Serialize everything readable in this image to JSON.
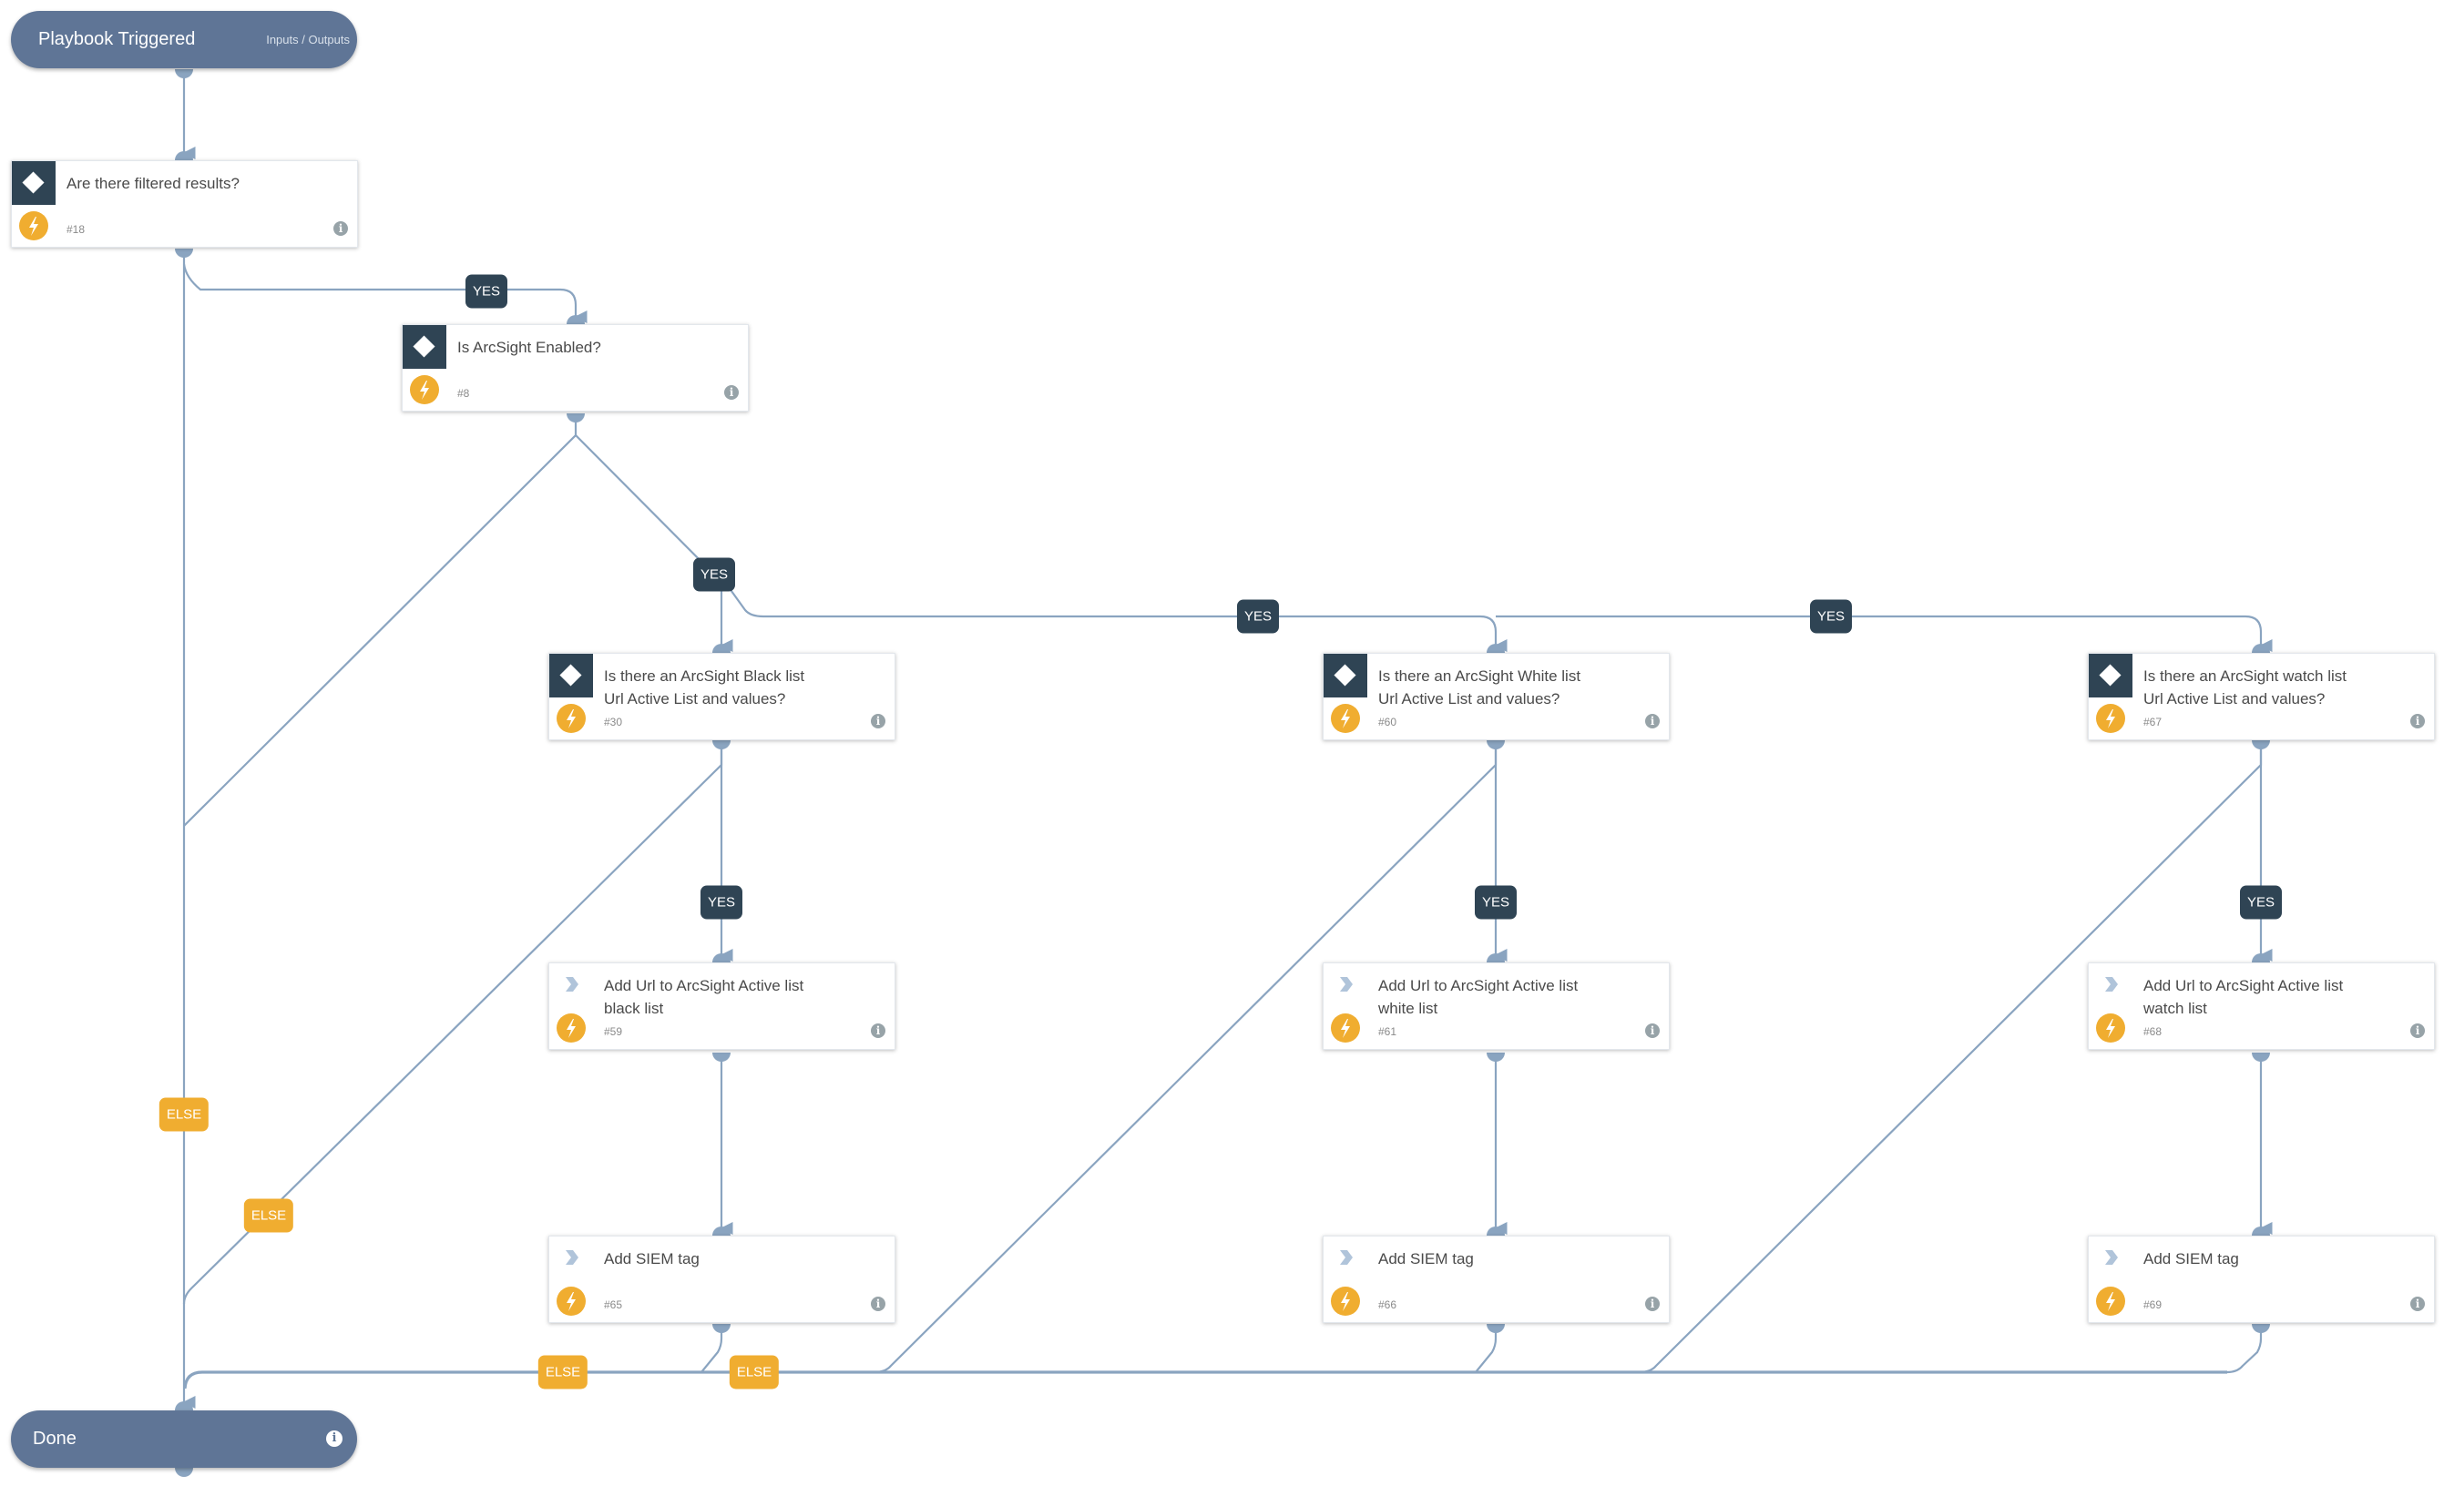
{
  "start": {
    "title": "Playbook Triggered",
    "io_label": "Inputs / Outputs"
  },
  "end": {
    "title": "Done",
    "info_icon": "info-icon"
  },
  "colors": {
    "pill": "#5f7596",
    "edge": "#8aa4c0",
    "yes": "#2f4454",
    "else": "#f0ad30",
    "condition_header": "#2f4454"
  },
  "tasks": [
    {
      "id": "18",
      "type": "condition",
      "name": "Are there filtered results?",
      "num": "#18"
    },
    {
      "id": "8",
      "type": "condition",
      "name": "Is ArcSight Enabled?",
      "num": "#8"
    },
    {
      "id": "30",
      "type": "condition",
      "name": "Is there an ArcSight Black list\nUrl Active List and values?",
      "num": "#30"
    },
    {
      "id": "60",
      "type": "condition",
      "name": "Is there an ArcSight White list\nUrl Active List and values?",
      "num": "#60"
    },
    {
      "id": "67",
      "type": "condition",
      "name": "Is there an ArcSight watch list\nUrl Active List and values?",
      "num": "#67"
    },
    {
      "id": "59",
      "type": "action",
      "name": "Add Url to ArcSight Active list\nblack list",
      "num": "#59"
    },
    {
      "id": "61",
      "type": "action",
      "name": "Add Url to ArcSight Active list\nwhite list",
      "num": "#61"
    },
    {
      "id": "68",
      "type": "action",
      "name": "Add Url to ArcSight Active list\nwatch list",
      "num": "#68"
    },
    {
      "id": "65",
      "type": "action",
      "name": "Add SIEM tag",
      "num": "#65"
    },
    {
      "id": "66",
      "type": "action",
      "name": "Add SIEM tag",
      "num": "#66"
    },
    {
      "id": "69",
      "type": "action",
      "name": "Add SIEM tag",
      "num": "#69"
    }
  ],
  "edge_labels": {
    "yes": "YES",
    "else": "ELSE"
  },
  "edges": [
    {
      "from": "start",
      "to": "18"
    },
    {
      "from": "18",
      "to": "8",
      "label": "YES"
    },
    {
      "from": "18",
      "to": "end",
      "label": "ELSE"
    },
    {
      "from": "8",
      "to": "30",
      "label": "YES"
    },
    {
      "from": "8",
      "to": "60",
      "label": "YES"
    },
    {
      "from": "8",
      "to": "67",
      "label": "YES"
    },
    {
      "from": "8",
      "to": "end"
    },
    {
      "from": "30",
      "to": "59",
      "label": "YES"
    },
    {
      "from": "30",
      "to": "end",
      "label": "ELSE"
    },
    {
      "from": "60",
      "to": "61",
      "label": "YES"
    },
    {
      "from": "60",
      "to": "end",
      "label": "ELSE"
    },
    {
      "from": "67",
      "to": "68",
      "label": "YES"
    },
    {
      "from": "67",
      "to": "end",
      "label": "ELSE"
    },
    {
      "from": "59",
      "to": "65"
    },
    {
      "from": "61",
      "to": "66"
    },
    {
      "from": "68",
      "to": "69"
    },
    {
      "from": "65",
      "to": "end"
    },
    {
      "from": "66",
      "to": "end"
    },
    {
      "from": "69",
      "to": "end"
    }
  ]
}
